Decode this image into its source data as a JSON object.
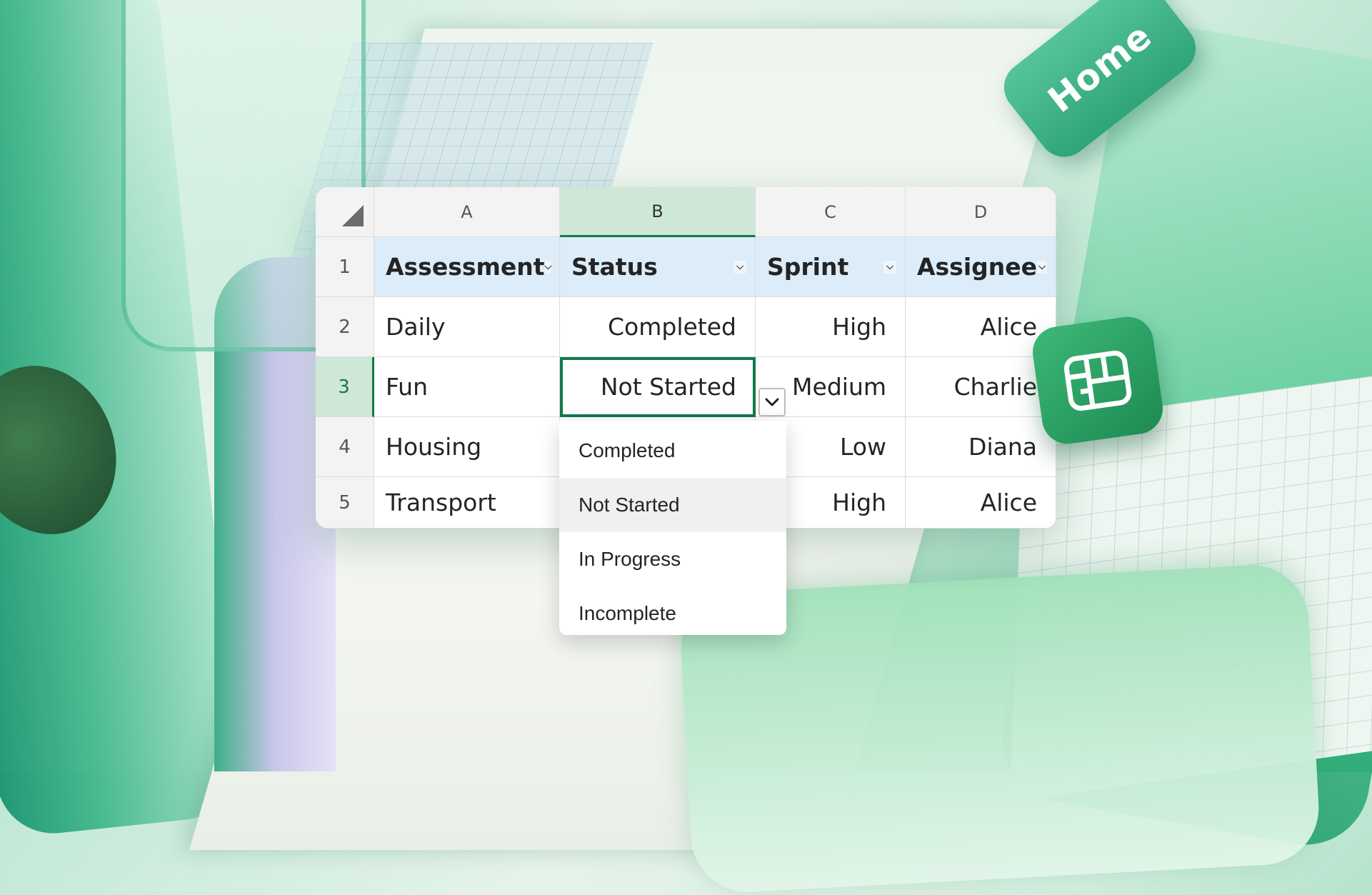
{
  "background": {
    "home_key_label": "Home"
  },
  "sheet": {
    "columns": [
      "A",
      "B",
      "C",
      "D"
    ],
    "active_column": "B",
    "rows": [
      "1",
      "2",
      "3",
      "4",
      "5"
    ],
    "active_row": "3",
    "headers": [
      "Assessment",
      "Status",
      "Sprint",
      "Assignee"
    ],
    "data": [
      [
        "Daily",
        "Completed",
        "High",
        "Alice"
      ],
      [
        "Fun",
        "Not Started",
        "Medium",
        "Charlie"
      ],
      [
        "Housing",
        "",
        "Low",
        "Diana"
      ],
      [
        "Transport",
        "",
        "High",
        "Alice"
      ]
    ],
    "selected_cell": "B3"
  },
  "dropdown": {
    "options": [
      "Completed",
      "Not Started",
      "In Progress",
      "Incomplete"
    ],
    "highlighted": "Not Started"
  },
  "colors": {
    "accent": "#117a4b",
    "header_fill": "#dcecf8",
    "active_header_fill": "#cfe7d6"
  },
  "icons": {
    "corner": "select-all-triangle-icon",
    "filter": "chevron-down-icon",
    "dropdown": "chevron-down-icon",
    "app": "excel-table-icon"
  }
}
